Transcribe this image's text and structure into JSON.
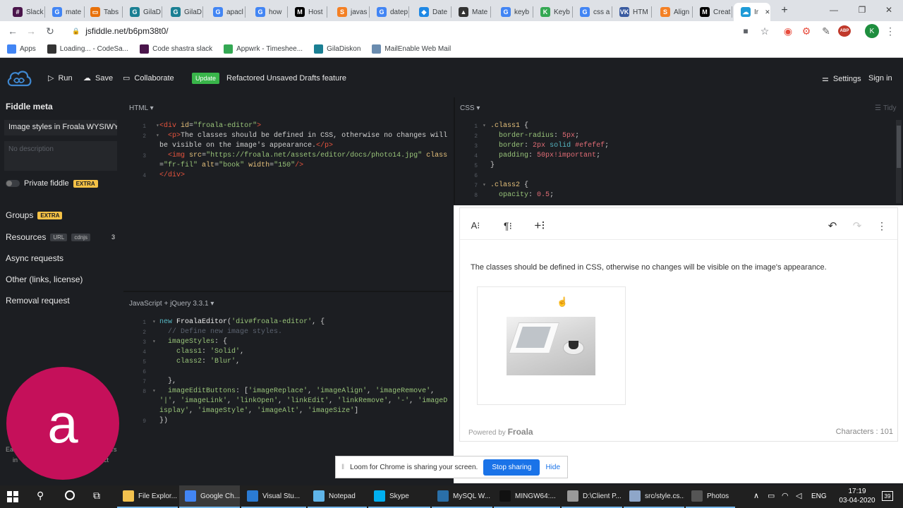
{
  "browser": {
    "tabs": [
      {
        "label": "Slack",
        "color": "#4a154b",
        "glyph": "#"
      },
      {
        "label": "mate",
        "color": "#4285f4",
        "glyph": "G"
      },
      {
        "label": "Tabs",
        "color": "#e8710a",
        "glyph": "▭"
      },
      {
        "label": "GilaD",
        "color": "#1a7f93",
        "glyph": "G"
      },
      {
        "label": "GilaD",
        "color": "#1a7f93",
        "glyph": "G"
      },
      {
        "label": "apacl",
        "color": "#4285f4",
        "glyph": "G"
      },
      {
        "label": "how",
        "color": "#4285f4",
        "glyph": "G"
      },
      {
        "label": "Host",
        "color": "#000000",
        "glyph": "M"
      },
      {
        "label": "javas",
        "color": "#f48024",
        "glyph": "S"
      },
      {
        "label": "datep",
        "color": "#4285f4",
        "glyph": "G"
      },
      {
        "label": "Date",
        "color": "#1e88e5",
        "glyph": "◆"
      },
      {
        "label": "Mate",
        "color": "#333333",
        "glyph": "▲"
      },
      {
        "label": "keyb",
        "color": "#4285f4",
        "glyph": "G"
      },
      {
        "label": "Keyb",
        "color": "#34a853",
        "glyph": "K"
      },
      {
        "label": "css a",
        "color": "#4285f4",
        "glyph": "G"
      },
      {
        "label": "HTM",
        "color": "#3a5ba0",
        "glyph": "VK"
      },
      {
        "label": "Align",
        "color": "#f48024",
        "glyph": "S"
      },
      {
        "label": "Creat",
        "color": "#000000",
        "glyph": "M"
      },
      {
        "label": "Ir",
        "color": "#1f9bd7",
        "glyph": "☁"
      }
    ],
    "new_tab": "+",
    "window": {
      "minimize": "—",
      "maximize": "❐",
      "close": "✕"
    },
    "url": "jsfiddle.net/b6pm38t0/",
    "nav": {
      "back": "←",
      "forward": "→",
      "reload": "↻",
      "lock": "🔒",
      "star": "☆",
      "menu": "⋮"
    },
    "profile": "K",
    "ext_badge": "ABP",
    "bookmarks": [
      {
        "label": "Apps",
        "color": "#4285f4"
      },
      {
        "label": "Loading... - CodeSa...",
        "color": "#333333"
      },
      {
        "label": "Code shastra slack",
        "color": "#4a154b"
      },
      {
        "label": "Appwrk - Timeshee...",
        "color": "#34a853"
      },
      {
        "label": "GilaDiskon",
        "color": "#1a7f93"
      },
      {
        "label": "MailEnable Web Mail",
        "color": "#6a8caf"
      }
    ]
  },
  "jsfiddle": {
    "run": "Run",
    "save": "Save",
    "collaborate": "Collaborate",
    "update_badge": "Update",
    "update_text": "Refactored Unsaved Drafts feature",
    "settings": "Settings",
    "signin": "Sign in",
    "sidebar": {
      "meta_title": "Fiddle meta",
      "fiddle_title": "Image styles in Froala WYSIWYG",
      "description_placeholder": "No description",
      "private_label": "Private fiddle",
      "private_badge": "EXTRA",
      "groups": "Groups",
      "groups_badge": "EXTRA",
      "resources": "Resources",
      "resources_url": "URL",
      "resources_cdnjs": "cdnjs",
      "resources_count": "3",
      "async": "Async requests",
      "other": "Other (links, license)",
      "removal": "Removal request",
      "partial_left": "Ea",
      "partial_left2": "in",
      "partial_right": "rs",
      "partial_right2": "ct"
    },
    "html_label": "HTML ▾",
    "css_label": "CSS ▾",
    "js_label": "JavaScript + jQuery 3.3.1 ▾",
    "tidy": "Tidy",
    "result_text": "The classes should be defined in CSS, otherwise no changes will be visible on the image's appearance.",
    "powered_by": "Powered by",
    "brand": "Froala",
    "characters": "Characters : 101"
  },
  "loom": {
    "message": "Loom for Chrome is sharing your screen.",
    "stop": "Stop sharing",
    "hide": "Hide"
  },
  "avatar_letter": "a",
  "taskbar": {
    "items": [
      {
        "label": "File Explor...",
        "color": "#f2c14e"
      },
      {
        "label": "Google Ch...",
        "color": "#4285f4"
      },
      {
        "label": "Visual Stu...",
        "color": "#2b7bd3"
      },
      {
        "label": "Notepad",
        "color": "#5fb4e8"
      },
      {
        "label": "Skype",
        "color": "#00aff0"
      },
      {
        "label": "MySQL W...",
        "color": "#2a6fa8"
      },
      {
        "label": "MINGW64:...",
        "color": "#111111"
      },
      {
        "label": "D:\\Client P...",
        "color": "#999999"
      },
      {
        "label": "src/style.cs...",
        "color": "#8ea6c9"
      },
      {
        "label": "Photos",
        "color": "#555555"
      }
    ],
    "lang": "ENG",
    "time": "17:19",
    "date": "03-04-2020",
    "notif": "39"
  }
}
